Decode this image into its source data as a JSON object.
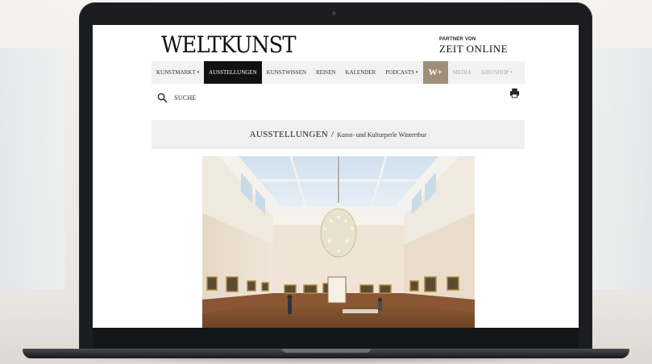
{
  "site": {
    "logo": "WELTKUNST",
    "partner_label": "PARTNER VON",
    "partner_brand": "ZEIT ONLINE"
  },
  "nav": {
    "items": [
      {
        "label": "KUNSTMARKT",
        "dropdown": true,
        "state": "normal"
      },
      {
        "label": "AUSSTELLUNGEN",
        "dropdown": false,
        "state": "active"
      },
      {
        "label": "KUNSTWISSEN",
        "dropdown": false,
        "state": "normal"
      },
      {
        "label": "REISEN",
        "dropdown": false,
        "state": "normal"
      },
      {
        "label": "KALENDER",
        "dropdown": false,
        "state": "normal"
      },
      {
        "label": "PODCASTS",
        "dropdown": true,
        "state": "normal"
      },
      {
        "label": "W+",
        "dropdown": false,
        "state": "premium"
      },
      {
        "label": "MEDIA",
        "dropdown": false,
        "state": "dim"
      },
      {
        "label": "ABO/SHOP",
        "dropdown": true,
        "state": "dim"
      }
    ],
    "dropdown_glyph": "▾"
  },
  "search": {
    "label": "SUCHE",
    "icon": "search-icon"
  },
  "print": {
    "icon": "printer-icon"
  },
  "section": {
    "title": "AUSSTELLUNGEN",
    "separator": "/",
    "subtitle": "Kunst- und Kulturperle Winterthur"
  },
  "hero": {
    "subject": "gallery-room-photo"
  },
  "colors": {
    "active_nav_bg": "#111111",
    "premium_bg": "#9f8f78",
    "nav_bg": "#f2f2f2",
    "section_bg": "#f0f0f0"
  }
}
